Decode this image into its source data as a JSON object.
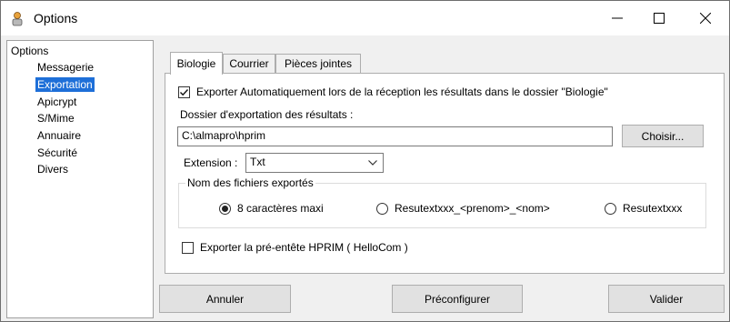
{
  "window": {
    "title": "Options",
    "app_icon": "app-icon",
    "controls": {
      "minimize_icon": "minimize-icon",
      "maximize_icon": "maximize-icon",
      "close_icon": "close-icon"
    }
  },
  "tree": {
    "root": "Options",
    "items": [
      {
        "label": "Messagerie",
        "selected": false
      },
      {
        "label": "Exportation",
        "selected": true
      },
      {
        "label": "Apicrypt",
        "selected": false
      },
      {
        "label": "S/Mime",
        "selected": false
      },
      {
        "label": "Annuaire",
        "selected": false
      },
      {
        "label": "Sécurité",
        "selected": false
      },
      {
        "label": "Divers",
        "selected": false
      }
    ]
  },
  "tabs": [
    {
      "label": "Biologie",
      "active": true
    },
    {
      "label": "Courrier",
      "active": false
    },
    {
      "label": "Pièces jointes",
      "active": false
    }
  ],
  "export": {
    "auto_export_label": "Exporter Automatiquement lors de la réception les résultats dans le dossier \"Biologie\"",
    "auto_export_checked": true,
    "folder_label": "Dossier d'exportation des résultats :",
    "folder_value": "C:\\almapro\\hprim",
    "choose_button": "Choisir...",
    "extension_label": "Extension :",
    "extension_value": "Txt",
    "filenames_group": "Nom des fichiers exportés",
    "filename_options": [
      {
        "label": "8 caractères maxi",
        "selected": true
      },
      {
        "label": "Resutextxxx_<prenom>_<nom>",
        "selected": false
      },
      {
        "label": "Resutextxxx",
        "selected": false
      }
    ],
    "hprim_header_label": "Exporter la pré-entête HPRIM ( HelloCom )",
    "hprim_header_checked": false
  },
  "footer": {
    "cancel_label": "Annuler",
    "preconfigure_label": "Préconfigurer",
    "validate_label": "Valider"
  }
}
